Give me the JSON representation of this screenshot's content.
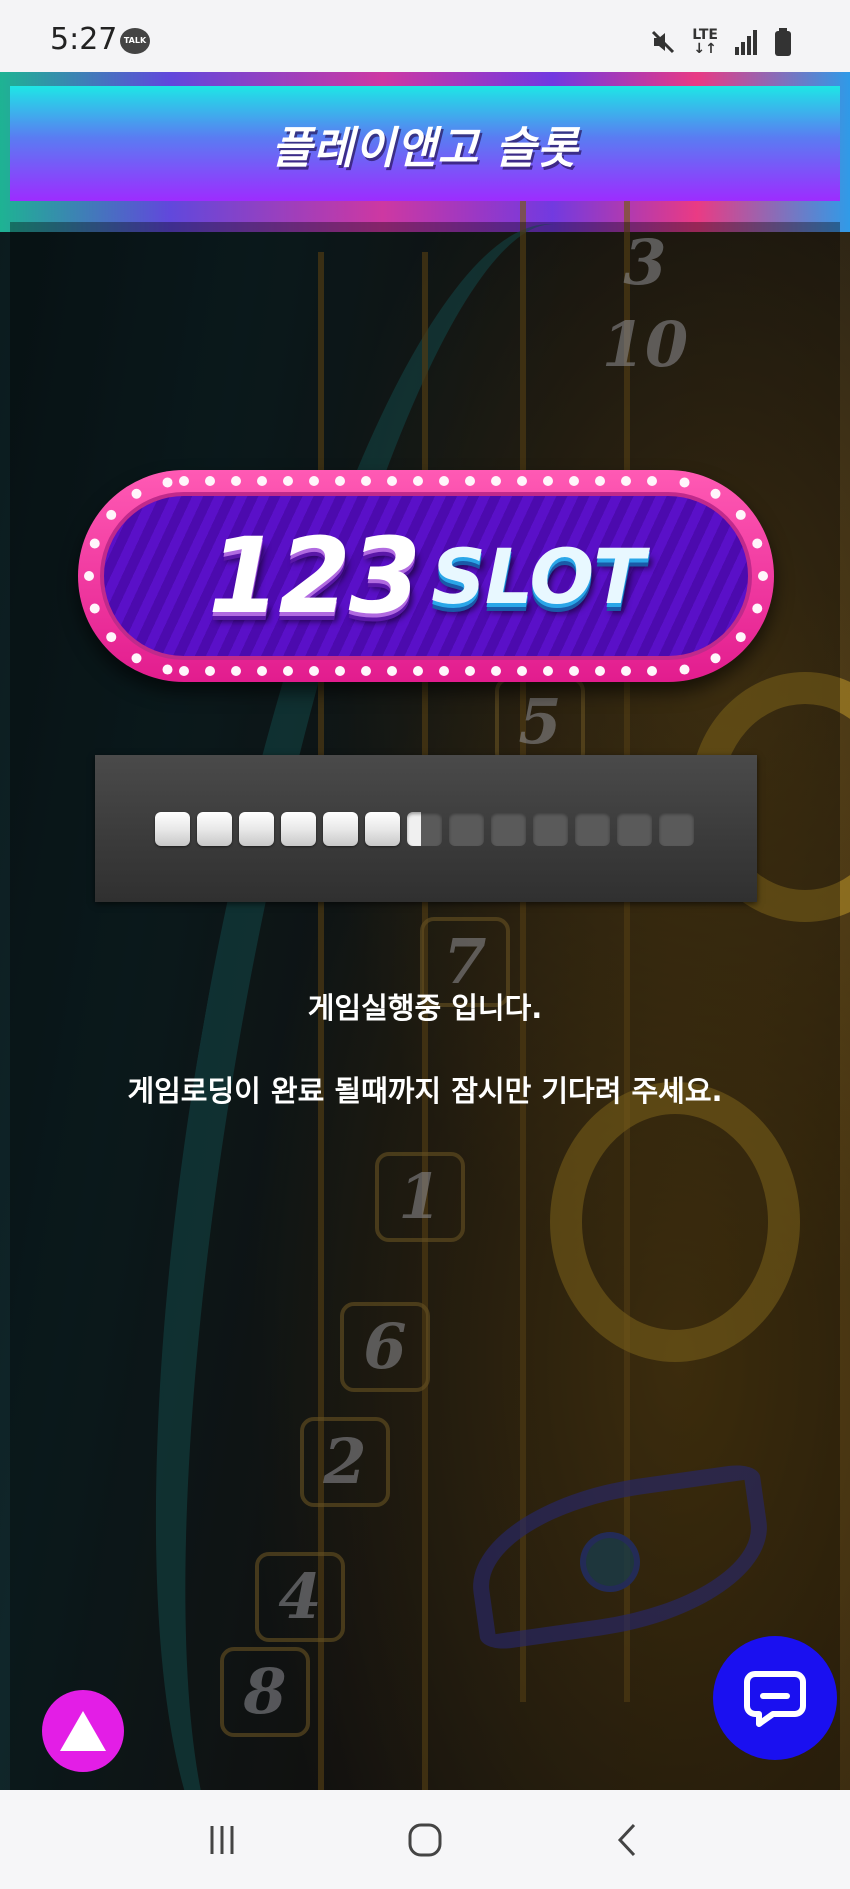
{
  "status_bar": {
    "time": "5:27",
    "talk_badge": "TALK",
    "network": "LTE"
  },
  "header": {
    "title": "플레이앤고 슬롯"
  },
  "logo": {
    "number": "123",
    "word": "SLOT"
  },
  "loading": {
    "total_segments": 13,
    "filled_segments": 6.4,
    "progress": 0.49
  },
  "messages": {
    "line1": "게임실행중 입니다.",
    "line2": "게임로딩이 완료 될때까지 잠시만 기다려 주세요."
  },
  "background_reel_numbers": [
    "3",
    "10",
    "5",
    "7",
    "1",
    "6",
    "2",
    "4",
    "8"
  ],
  "colors": {
    "header_top": "#1ee6e6",
    "header_bottom": "#9d2cff",
    "logo_frame": "#e21c8e",
    "logo_inner": "#5a10c8",
    "top_button": "#e31ee6",
    "chat_button": "#1a10f0"
  },
  "icons": {
    "top_button": "triangle-up-icon",
    "chat_button": "chat-bubble-icon",
    "nav_recents": "recents-icon",
    "nav_home": "home-icon",
    "nav_back": "back-icon"
  }
}
